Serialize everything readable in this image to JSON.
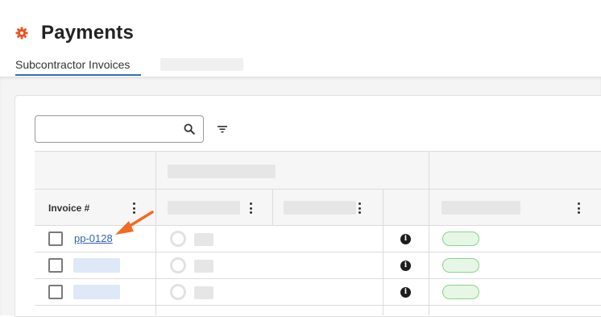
{
  "header": {
    "title": "Payments",
    "icon": "gear-icon",
    "accent_color": "#e8541f"
  },
  "tabs": [
    {
      "label": "Subcontractor Invoices",
      "active": true
    }
  ],
  "search": {
    "value": "",
    "placeholder": ""
  },
  "table": {
    "columns": [
      {
        "label": "Invoice #"
      }
    ],
    "rows": [
      {
        "invoice": "pp-0128"
      }
    ]
  },
  "colors": {
    "link": "#2f63b8",
    "tab_underline": "#2f6fc0",
    "status_pill_bg": "#e6f7e6",
    "status_pill_border": "#8fd08f",
    "annotation_arrow": "#f26b22"
  }
}
